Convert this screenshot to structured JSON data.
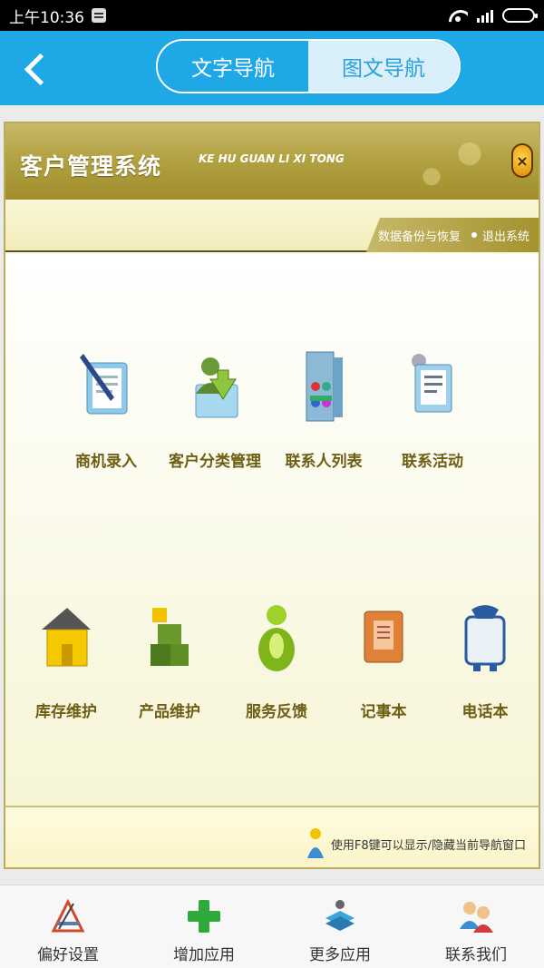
{
  "status_bar": {
    "time": "上午10:36"
  },
  "header": {
    "tabs": [
      {
        "label": "文字导航",
        "active": false
      },
      {
        "label": "图文导航",
        "active": true
      }
    ],
    "accent": "#1ea8e6"
  },
  "system": {
    "title": "客户管理系统",
    "pinyin": "KE HU GUAN LI XI TONG",
    "links": [
      "数据备份与恢复",
      "退出系统"
    ],
    "close_glyph": "×"
  },
  "apps_row1": [
    {
      "label": "商机录入",
      "icon": "business-entry-icon"
    },
    {
      "label": "客户分类管理",
      "icon": "customer-classify-icon"
    },
    {
      "label": "联系人列表",
      "icon": "contact-list-icon"
    },
    {
      "label": "联系活动",
      "icon": "contact-activity-icon"
    }
  ],
  "apps_row2": [
    {
      "label": "库存维护",
      "icon": "inventory-icon"
    },
    {
      "label": "产品维护",
      "icon": "product-icon"
    },
    {
      "label": "服务反馈",
      "icon": "service-feedback-icon"
    },
    {
      "label": "记事本",
      "icon": "notepad-icon"
    },
    {
      "label": "电话本",
      "icon": "phonebook-icon"
    }
  ],
  "footer_tip": "使用F8键可以显示/隐藏当前导航窗口",
  "bottom_nav": [
    {
      "label": "偏好设置",
      "icon": "preferences-icon"
    },
    {
      "label": "增加应用",
      "icon": "add-app-icon"
    },
    {
      "label": "更多应用",
      "icon": "more-apps-icon"
    },
    {
      "label": "联系我们",
      "icon": "contact-us-icon"
    }
  ]
}
